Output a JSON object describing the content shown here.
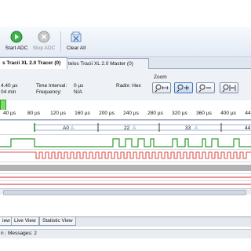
{
  "toolbar": {
    "start_adc": "Start ADC",
    "stop_adc": "Stop ADC",
    "clear_all": "Clear All"
  },
  "tabs": [
    {
      "label": "s Tracii XL 2.0 Tracer (0)",
      "active": true
    },
    {
      "label": "telos Tracii XL 2.0 Master (0)",
      "active": false
    }
  ],
  "info": {
    "value1": "4.40 µs",
    "value2": "04 min",
    "time_interval_label": "Time Interval:",
    "time_interval_value": "0 µs",
    "frequency_label": "Frequency:",
    "frequency_value": "N/A",
    "radix_label": "Radix: Hex",
    "zoom_label": "Zoom"
  },
  "ruler": {
    "labels": [
      "40 µs",
      "80 µs",
      "120 µs",
      "160 µs",
      "200 µs",
      "240 µs",
      "280 µs",
      "320 µs",
      "360 µs",
      "400 µs",
      "44"
    ]
  },
  "bus_values": [
    {
      "text": "A0",
      "suffix": "A"
    },
    {
      "text": "22",
      "suffix": "A"
    },
    {
      "text": "33",
      "suffix": "A"
    },
    {
      "text": "44",
      "suffix": ""
    }
  ],
  "bottom_tabs": [
    {
      "label": "iew",
      "active": false
    },
    {
      "label": "Live View",
      "active": false
    },
    {
      "label": "Statistic View",
      "active": false
    }
  ],
  "status": {
    "left": "n",
    "messages": "Messages: 2"
  },
  "colors": {
    "green_trace": "#2e9a2e",
    "red_trace": "#e0524f",
    "gray_band": "#b3b3b3",
    "bus_line": "#9fb0c8"
  }
}
